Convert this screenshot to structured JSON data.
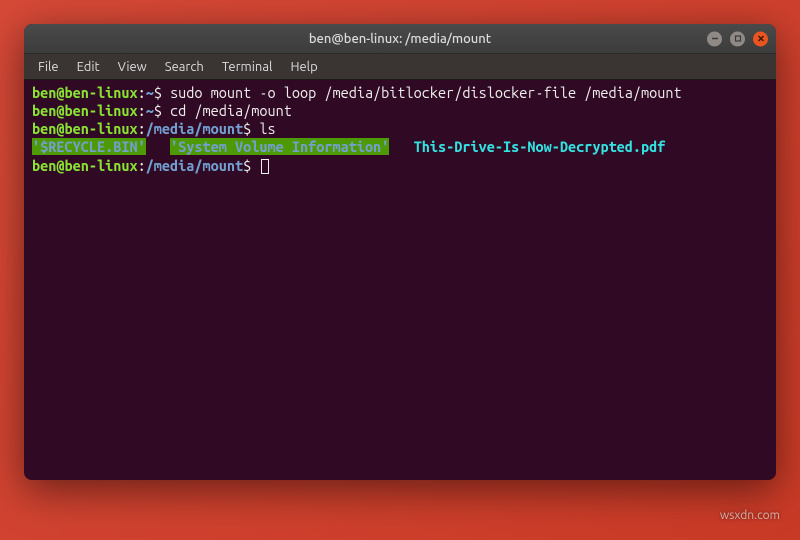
{
  "window": {
    "title": "ben@ben-linux: /media/mount"
  },
  "menubar": {
    "items": [
      "File",
      "Edit",
      "View",
      "Search",
      "Terminal",
      "Help"
    ]
  },
  "terminal": {
    "lines": [
      {
        "prompt": {
          "user": "ben@ben-linux",
          "sep": ":",
          "path": "~",
          "dollar": "$"
        },
        "command": "sudo mount -o loop /media/bitlocker/dislocker-file /media/mount"
      },
      {
        "prompt": {
          "user": "ben@ben-linux",
          "sep": ":",
          "path": "~",
          "dollar": "$"
        },
        "command": "cd /media/mount"
      },
      {
        "prompt": {
          "user": "ben@ben-linux",
          "sep": ":",
          "path": "/media/mount",
          "dollar": "$"
        },
        "command": "ls"
      }
    ],
    "ls_output": {
      "item1": "'$RECYCLE.BIN'",
      "item2": "'System Volume Information'",
      "item3": "This-Drive-Is-Now-Decrypted.pdf"
    },
    "final_prompt": {
      "user": "ben@ben-linux",
      "sep": ":",
      "path": "/media/mount",
      "dollar": "$"
    }
  },
  "watermark": "wsxdn.com"
}
